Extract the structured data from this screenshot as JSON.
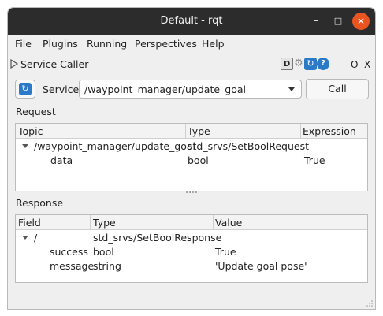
{
  "window": {
    "title": "Default - rqt"
  },
  "menubar": {
    "items": [
      {
        "label": "File"
      },
      {
        "label": "Plugins"
      },
      {
        "label": "Running"
      },
      {
        "label": "Perspectives"
      },
      {
        "label": "Help"
      }
    ]
  },
  "plugin": {
    "title": "Service Caller",
    "icons": [
      "D",
      "gear-icon",
      "reload-icon",
      "help-icon"
    ],
    "controls": {
      "dash": "-",
      "o": "O",
      "x": "X"
    }
  },
  "service": {
    "label": "Service",
    "selected": "/waypoint_manager/update_goal",
    "call_label": "Call"
  },
  "request": {
    "label": "Request",
    "columns": [
      "Topic",
      "Type",
      "Expression"
    ],
    "rows": [
      {
        "topic": "/waypoint_manager/update_goal",
        "type": "std_srvs/SetBoolRequest",
        "expression": ""
      },
      {
        "topic": "data",
        "type": "bool",
        "expression": "True"
      }
    ]
  },
  "response": {
    "label": "Response",
    "columns": [
      "Field",
      "Type",
      "Value"
    ],
    "rows": [
      {
        "field": "/",
        "type": "std_srvs/SetBoolResponse",
        "value": ""
      },
      {
        "field": "success",
        "type": "bool",
        "value": "True"
      },
      {
        "field": "message",
        "type": "string",
        "value": "'Update goal pose'"
      }
    ]
  },
  "colors": {
    "titlebar": "#2c2c2c",
    "close": "#e95420",
    "window_bg": "#efefef",
    "accent": "#2a7ac8"
  }
}
